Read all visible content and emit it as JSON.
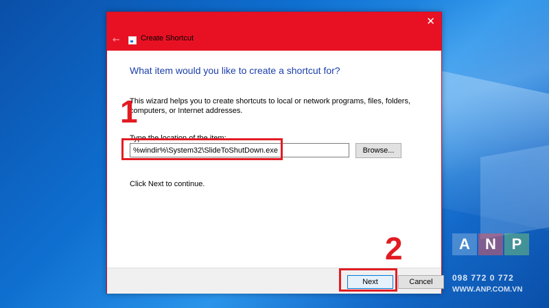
{
  "window": {
    "title": "Create Shortcut",
    "close_glyph": "✕",
    "back_glyph": "←"
  },
  "content": {
    "heading": "What item would you like to create a shortcut for?",
    "description": "This wizard helps you to create shortcuts to local or network programs, files, folders, computers, or Internet addresses.",
    "location_label": "Type the location of the item:",
    "location_value": "%windir%\\System32\\SlideToShutDown.exe",
    "browse_label": "Browse...",
    "continue_text": "Click Next to continue."
  },
  "footer": {
    "next_label": "Next",
    "cancel_label": "Cancel"
  },
  "annotations": {
    "step1": "1",
    "step2": "2"
  },
  "watermark": {
    "letters": [
      "A",
      "N",
      "P"
    ],
    "phone": "098 772 0 772",
    "url": "WWW.ANP.COM.VN"
  },
  "colors": {
    "titlebar": "#e81123",
    "heading": "#1a3eaa",
    "annotation": "#e21b23",
    "next_border": "#0078d7"
  }
}
